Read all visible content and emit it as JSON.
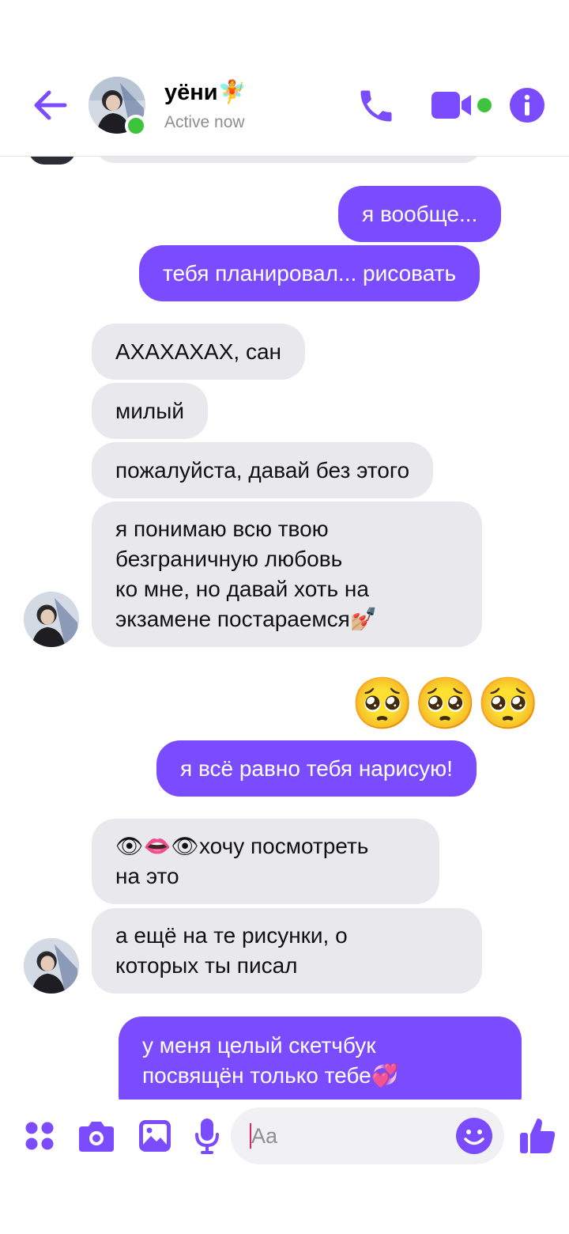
{
  "header": {
    "name": "уёни🧚",
    "status": "Active now"
  },
  "messages": [
    {
      "side": "out",
      "text": "я вообще..."
    },
    {
      "side": "out",
      "text": "тебя планировал... рисовать"
    },
    {
      "side": "in",
      "text": "АХАХАХАХ, сан"
    },
    {
      "side": "in",
      "text": "милый"
    },
    {
      "side": "in",
      "text": "пожалуйста, давай без этого"
    },
    {
      "side": "in",
      "text": "я понимаю всю твою\nбезграничную любовь\nко мне, но давай хоть на\nэкзамене постараемся💅🏼"
    },
    {
      "side": "out",
      "text": "🥺🥺🥺"
    },
    {
      "side": "out",
      "text": "я всё равно тебя нарисую!"
    },
    {
      "side": "in",
      "text": "👁👄👁хочу посмотреть\n на это"
    },
    {
      "side": "in",
      "text": "а ещё на те рисунки, о\nкоторых ты писал"
    },
    {
      "side": "out",
      "text": "у меня целый скетчбук\nпосвящён только тебе💞"
    }
  ],
  "composer": {
    "placeholder": "Aa"
  },
  "colors": {
    "accent": "#7b4cff",
    "incoming_bubble": "#e9e8ed",
    "online": "#3cc43c"
  },
  "icons": [
    "back-arrow-icon",
    "phone-icon",
    "video-camera-icon",
    "info-icon",
    "apps-icon",
    "camera-icon",
    "gallery-icon",
    "microphone-icon",
    "emoji-icon",
    "thumbs-up-icon"
  ]
}
